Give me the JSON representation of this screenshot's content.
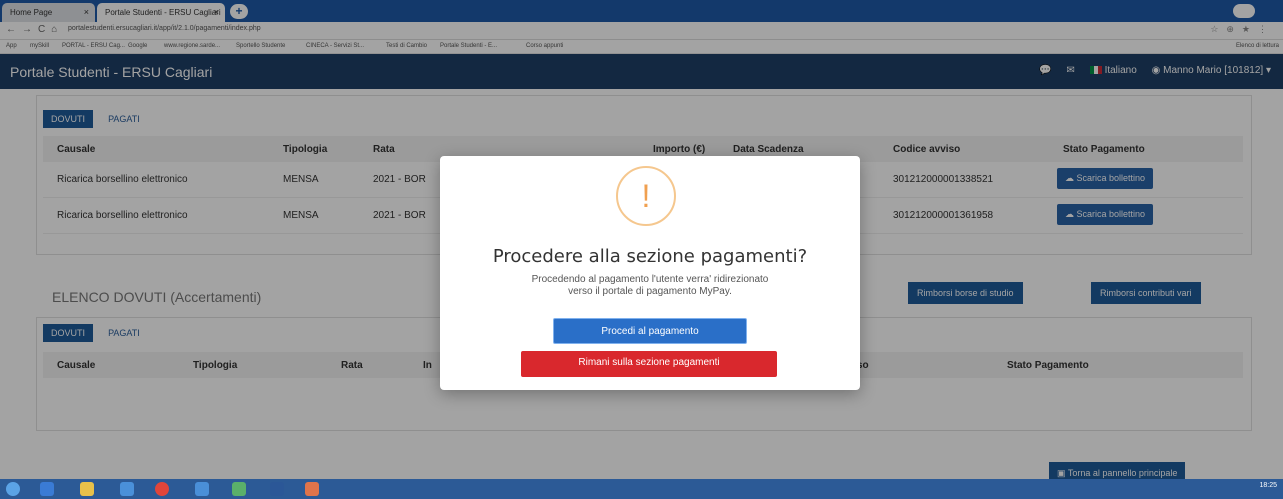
{
  "browser": {
    "tabs": [
      {
        "label": "Home Page"
      },
      {
        "label": "Portale Studenti - ERSU Cagliari"
      }
    ],
    "url": "portalestudenti.ersucagliari.it/app/it/2.1.0/pagamenti/index.php",
    "bookmarks": [
      "App",
      "mySkill",
      "PORTAL - ERSU Cag...",
      "Google",
      "www.regione.sarde...",
      "Sportello Studente",
      "CINECA - Servizi St...",
      "Testi di Cambio",
      "Portale Studenti - E...",
      "Corso appunti"
    ],
    "reading_list": "Elenco di lettura"
  },
  "header": {
    "title": "Portale Studenti - ERSU Cagliari",
    "language": "Italiano",
    "user": "Manno Mario [101812]"
  },
  "panel1": {
    "tabs": {
      "active": "DOVUTI",
      "inactive": "PAGATI"
    },
    "columns": [
      "Causale",
      "Tipologia",
      "Rata",
      "Importo (€)",
      "Data Scadenza",
      "Codice avviso",
      "Stato Pagamento"
    ],
    "rows": [
      {
        "causale": "Ricarica borsellino elettronico",
        "tipologia": "MENSA",
        "rata": "2021 - BOR",
        "codice": "301212000001338521",
        "button": "Scarica bollettino"
      },
      {
        "causale": "Ricarica borsellino elettronico",
        "tipologia": "MENSA",
        "rata": "2021 - BOR",
        "codice": "301212000001361958",
        "button": "Scarica bollettino"
      }
    ]
  },
  "section2": {
    "title": "ELENCO DOVUTI (Accertamenti)",
    "btn_borse": "Rimborsi borse di studio",
    "btn_contributi": "Rimborsi contributi vari",
    "tabs": {
      "active": "DOVUTI",
      "inactive": "PAGATI"
    },
    "columns": [
      "Causale",
      "Tipologia",
      "Rata",
      "In",
      "vviso",
      "Stato Pagamento"
    ],
    "back_button": "Torna al pannello principale"
  },
  "modal": {
    "icon": "!",
    "title": "Procedere alla sezione pagamenti?",
    "text_line1": "Procedendo al pagamento l'utente verra' ridirezionato",
    "text_line2": "verso il portale di pagamento MyPay.",
    "confirm_label": "Procedi al pagamento",
    "cancel_label": "Rimani sulla sezione pagamenti"
  },
  "taskbar": {
    "clock": "18:25"
  },
  "colors": {
    "header_bg": "#1f3f66",
    "primary": "#1f5b9a",
    "confirm": "#2a6fc8",
    "danger": "#d9282d",
    "warning": "#f0a050"
  }
}
